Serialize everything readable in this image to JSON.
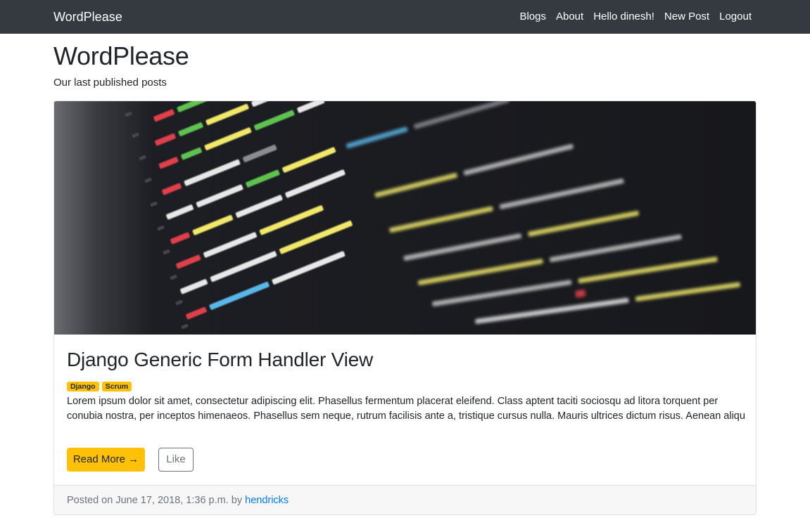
{
  "navbar": {
    "brand": "WordPlease",
    "links": [
      "Blogs",
      "About",
      "Hello dinesh!",
      "New Post",
      "Logout"
    ]
  },
  "header": {
    "title": "WordPlease",
    "subtitle": "Our last published posts"
  },
  "post": {
    "image_icon": "code-screenshot-image",
    "title": "Django Generic Form Handler View",
    "tags": [
      "Django",
      "Scrum"
    ],
    "excerpt": "Lorem ipsum dolor sit amet, consectetur adipiscing elit. Phasellus fermentum placerat eleifend. Class aptent taciti sociosqu ad litora torquent per conubia nostra, per inceptos himenaeos. Phasellus sem neque, rutrum facilisis ante a, tristique cursus nulla. Mauris ultrices dictum risus. Aenean aliqu",
    "read_more_label": "Read More →",
    "like_label": "Like",
    "footer": {
      "posted_prefix": "Posted on June 17, 2018, 1:36 p.m. by",
      "author": "hendricks"
    }
  },
  "colors": {
    "navbar_bg": "#343a40",
    "accent_warning": "#ffc107",
    "link": "#007bff",
    "secondary": "#6c757d"
  }
}
